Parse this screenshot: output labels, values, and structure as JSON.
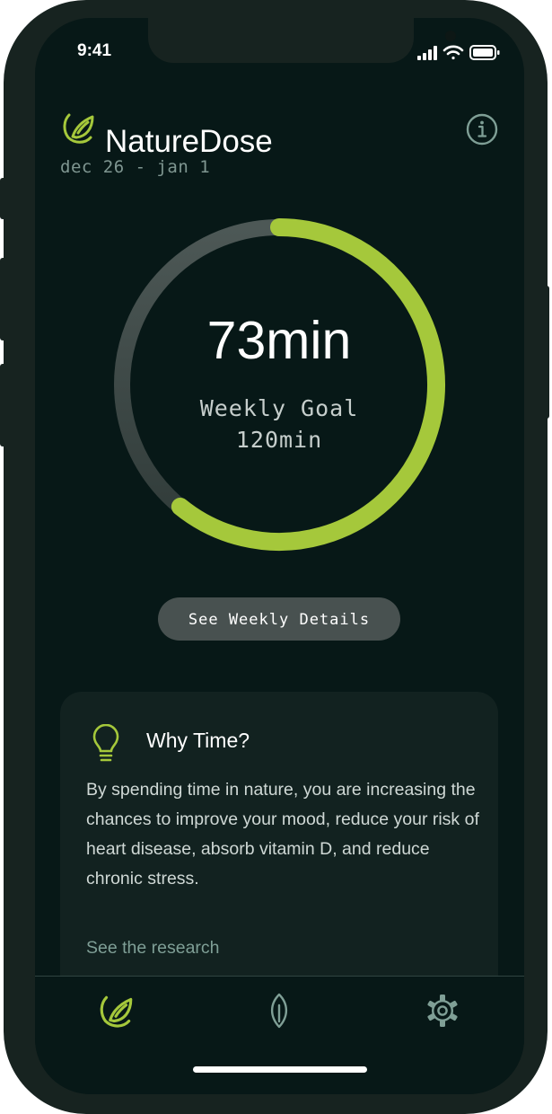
{
  "status_bar": {
    "time": "9:41"
  },
  "header": {
    "title": "NatureDose",
    "date_range": "dec 26 - jan 1"
  },
  "progress": {
    "value_text": "73min",
    "label": "Weekly Goal",
    "goal_text": "120min",
    "current_minutes": 73,
    "goal_minutes": 120
  },
  "details_button": {
    "label": "See Weekly Details"
  },
  "info_card": {
    "title": "Why Time?",
    "body": "By spending time in nature, you are increasing the chances to improve your mood, reduce your risk of heart disease, absorb vitamin D, and reduce chronic stress.",
    "link": "See the research"
  },
  "tabs": [
    {
      "icon": "leaf-logo-icon",
      "active": true
    },
    {
      "icon": "leaf-icon",
      "active": false
    },
    {
      "icon": "gear-icon",
      "active": false
    }
  ],
  "colors": {
    "accent": "#a5c83b",
    "background": "#071817",
    "card": "#122220",
    "track": "#4b5654",
    "muted_text": "#7f9691"
  }
}
